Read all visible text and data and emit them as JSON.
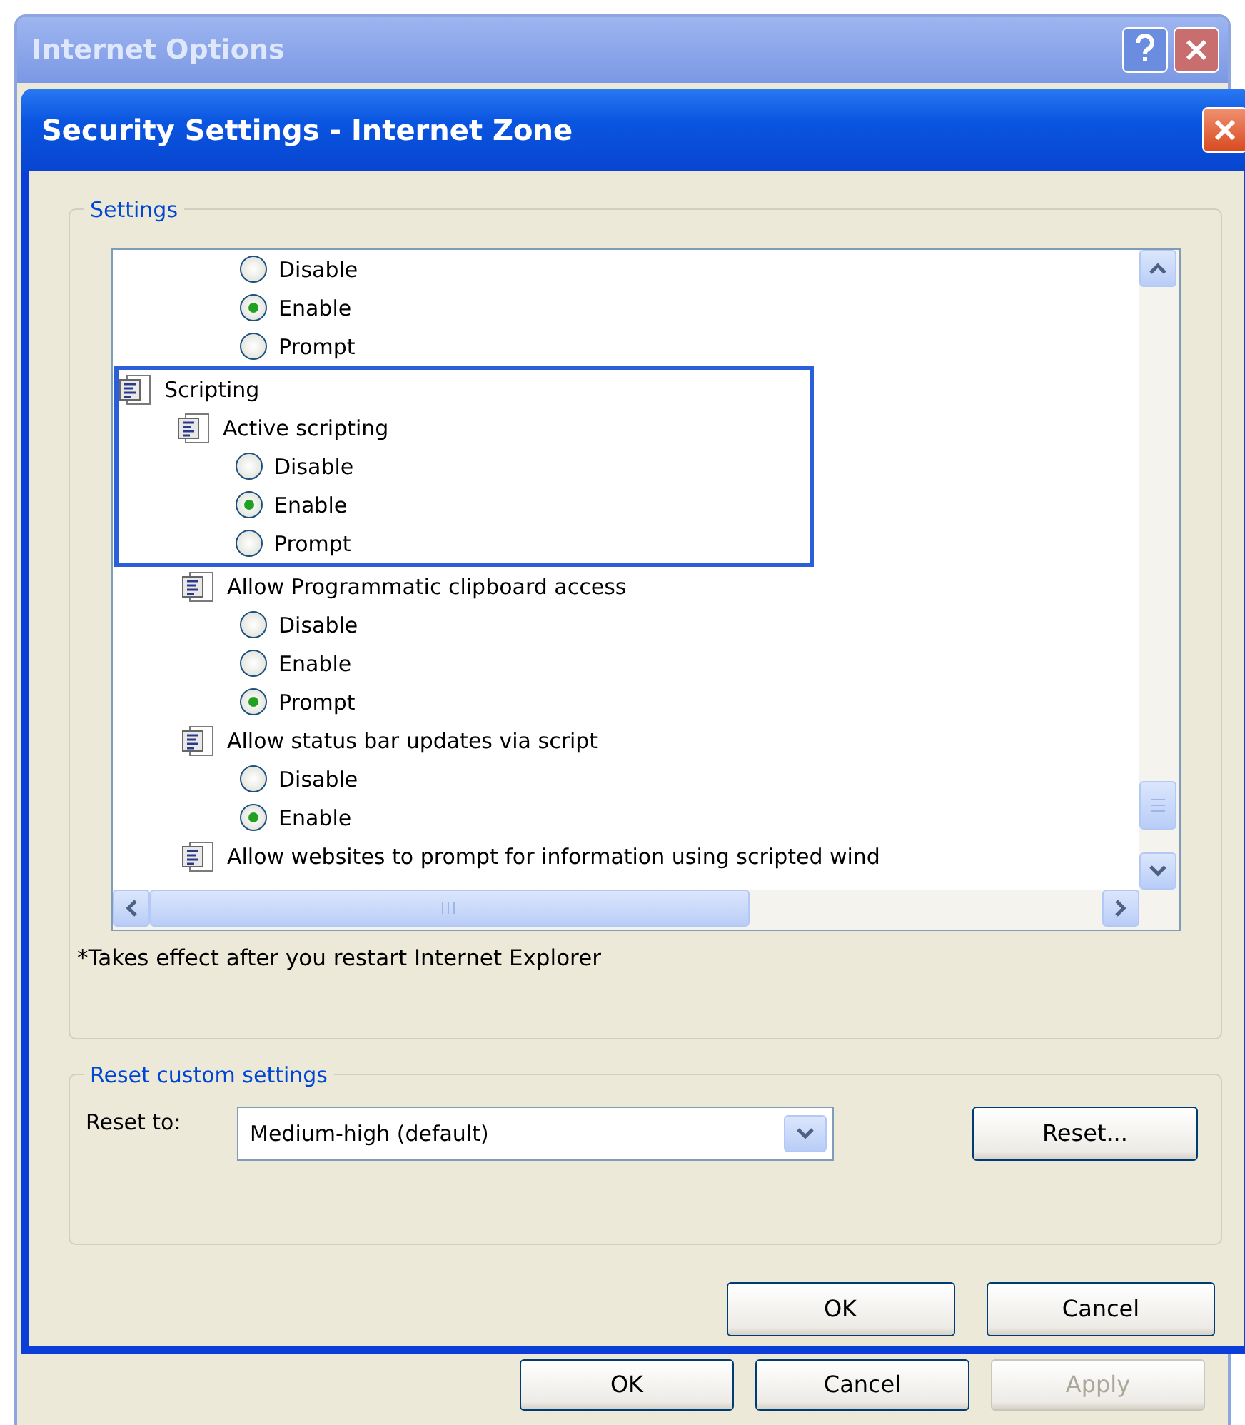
{
  "outer_window": {
    "title": "Internet Options",
    "buttons": [
      {
        "label": "OK",
        "disabled": false
      },
      {
        "label": "Cancel",
        "disabled": false
      },
      {
        "label": "Apply",
        "disabled": true
      }
    ]
  },
  "dialog": {
    "title": "Security Settings - Internet Zone",
    "settings": {
      "legend": "Settings",
      "tree": [
        {
          "children": [
            {
              "children": [
                {
                  "kind": "radio",
                  "label": "Disable",
                  "selected": false,
                  "highlighted": false
                },
                {
                  "kind": "radio",
                  "label": "Enable",
                  "selected": true,
                  "highlighted": false
                },
                {
                  "kind": "radio",
                  "label": "Prompt",
                  "selected": false,
                  "highlighted": false
                }
              ]
            }
          ]
        },
        {
          "kind": "setting",
          "label": "Scripting",
          "highlighted": true,
          "children": [
            {
              "kind": "setting",
              "label": "Active scripting",
              "highlighted": true,
              "children": [
                {
                  "kind": "radio",
                  "label": "Disable",
                  "selected": false,
                  "highlighted": true
                },
                {
                  "kind": "radio",
                  "label": "Enable",
                  "selected": true,
                  "highlighted": true
                },
                {
                  "kind": "radio",
                  "label": "Prompt",
                  "selected": false,
                  "highlighted": true
                }
              ]
            },
            {
              "kind": "setting",
              "label": "Allow Programmatic clipboard access",
              "highlighted": false,
              "children": [
                {
                  "kind": "radio",
                  "label": "Disable",
                  "selected": false,
                  "highlighted": false
                },
                {
                  "kind": "radio",
                  "label": "Enable",
                  "selected": false,
                  "highlighted": false
                },
                {
                  "kind": "radio",
                  "label": "Prompt",
                  "selected": true,
                  "highlighted": false
                }
              ]
            },
            {
              "kind": "setting",
              "label": "Allow status bar updates via script",
              "highlighted": false,
              "children": [
                {
                  "kind": "radio",
                  "label": "Disable",
                  "selected": false,
                  "highlighted": false
                },
                {
                  "kind": "radio",
                  "label": "Enable",
                  "selected": true,
                  "highlighted": false
                }
              ]
            },
            {
              "kind": "setting",
              "label": "Allow websites to prompt for information using scripted wind",
              "highlighted": false
            }
          ]
        }
      ],
      "note": "*Takes effect after you restart Internet Explorer"
    },
    "reset": {
      "legend": "Reset custom settings",
      "label": "Reset to:",
      "value": "Medium-high (default)",
      "button": "Reset..."
    },
    "buttons": [
      "OK",
      "Cancel"
    ]
  }
}
